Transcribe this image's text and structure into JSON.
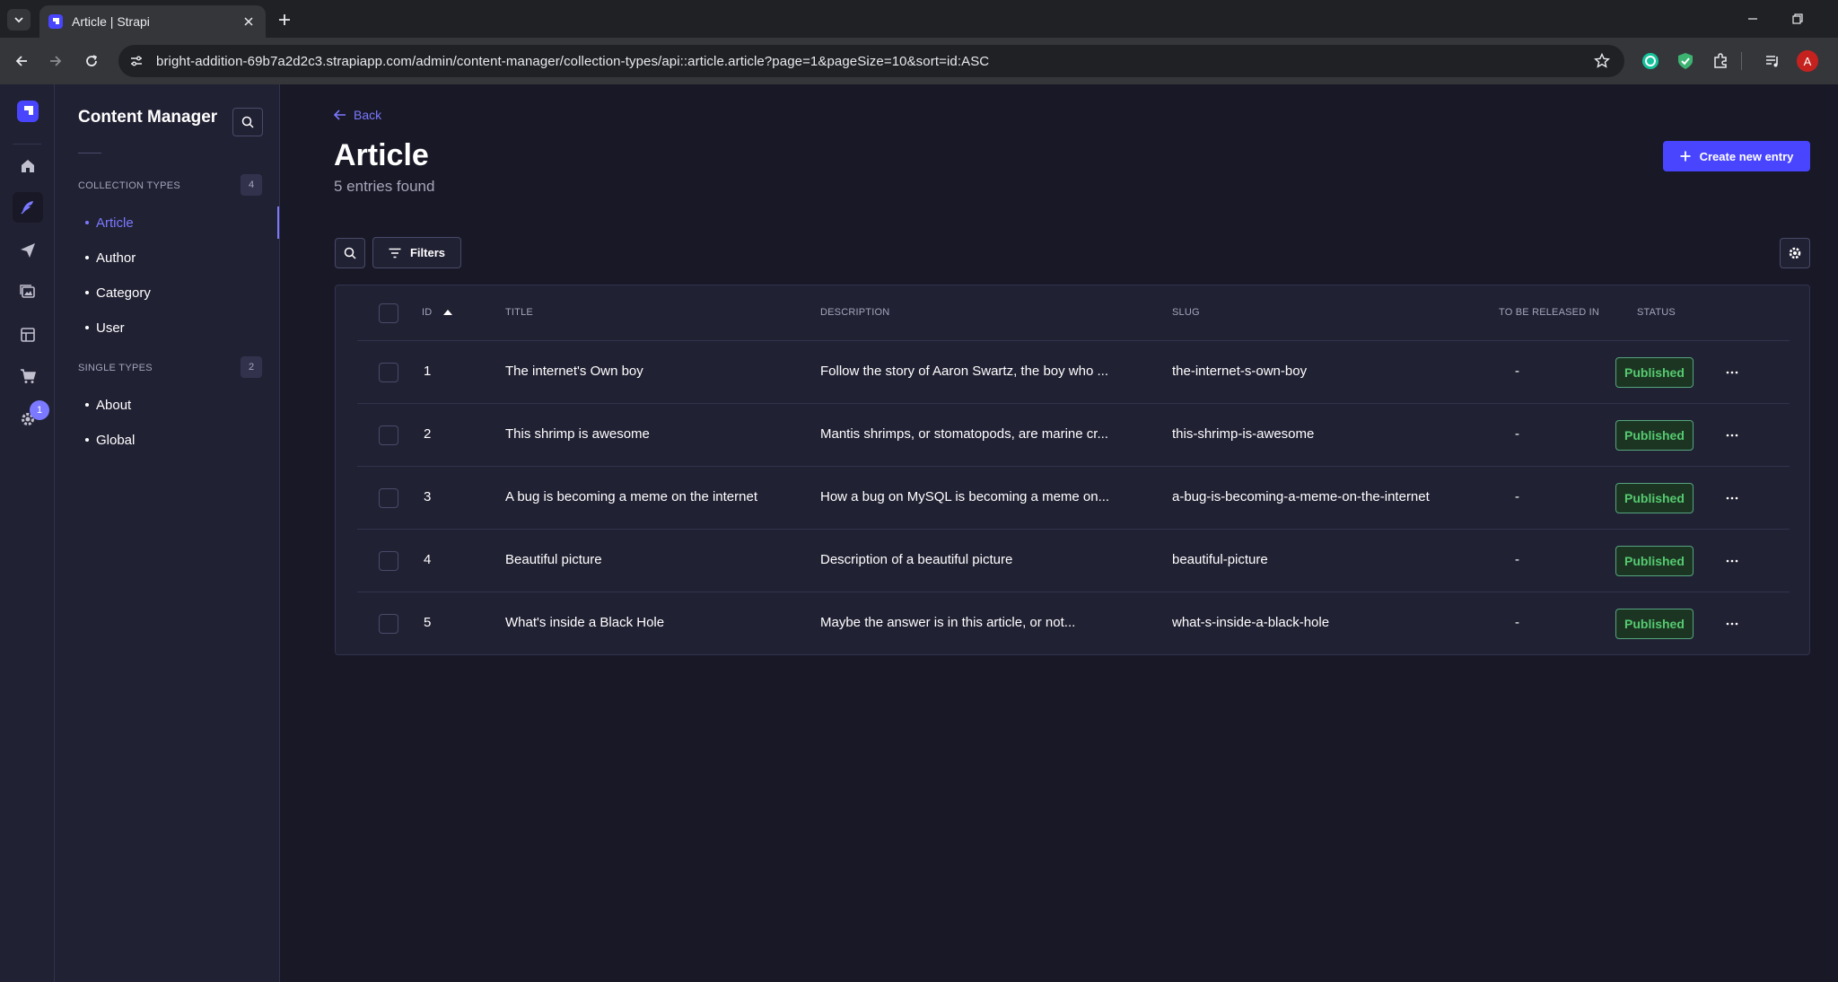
{
  "browser": {
    "tab_title": "Article | Strapi",
    "url": "bright-addition-69b7a2d2c3.strapiapp.com/admin/content-manager/collection-types/api::article.article?page=1&pageSize=10&sort=id:ASC",
    "profile_initial": "A"
  },
  "mainnav": {
    "settings_badge": "1"
  },
  "subnav": {
    "title": "Content Manager",
    "collection_label": "COLLECTION TYPES",
    "collection_count": "4",
    "collection_items": [
      "Article",
      "Author",
      "Category",
      "User"
    ],
    "single_label": "SINGLE TYPES",
    "single_count": "2",
    "single_items": [
      "About",
      "Global"
    ]
  },
  "header": {
    "back_label": "Back",
    "title": "Article",
    "subtitle": "5 entries found",
    "create_label": "Create new entry"
  },
  "actions": {
    "filters_label": "Filters"
  },
  "table": {
    "columns": [
      "ID",
      "TITLE",
      "DESCRIPTION",
      "SLUG",
      "TO BE RELEASED IN",
      "STATUS"
    ],
    "rows": [
      {
        "id": "1",
        "title": "The internet's Own boy",
        "description": "Follow the story of Aaron Swartz, the boy who ...",
        "slug": "the-internet-s-own-boy",
        "release": "-",
        "status": "Published"
      },
      {
        "id": "2",
        "title": "This shrimp is awesome",
        "description": "Mantis shrimps, or stomatopods, are marine cr...",
        "slug": "this-shrimp-is-awesome",
        "release": "-",
        "status": "Published"
      },
      {
        "id": "3",
        "title": "A bug is becoming a meme on the internet",
        "description": "How a bug on MySQL is becoming a meme on...",
        "slug": "a-bug-is-becoming-a-meme-on-the-internet",
        "release": "-",
        "status": "Published"
      },
      {
        "id": "4",
        "title": "Beautiful picture",
        "description": "Description of a beautiful picture",
        "slug": "beautiful-picture",
        "release": "-",
        "status": "Published"
      },
      {
        "id": "5",
        "title": "What's inside a Black Hole",
        "description": "Maybe the answer is in this article, or not...",
        "slug": "what-s-inside-a-black-hole",
        "release": "-",
        "status": "Published"
      }
    ]
  },
  "colors": {
    "primary": "#4945ff",
    "primary_light": "#7b79ff",
    "background": "#181826",
    "surface": "#212134",
    "success": "#55cb6f"
  }
}
